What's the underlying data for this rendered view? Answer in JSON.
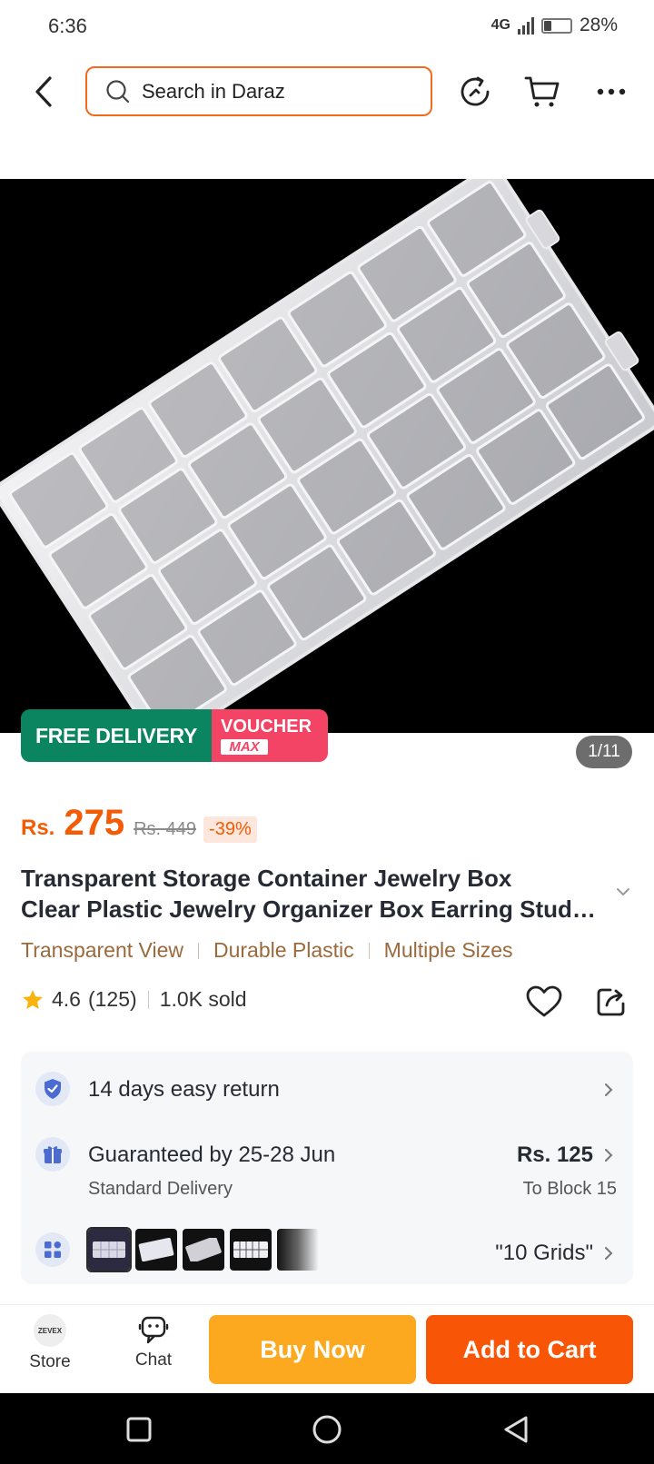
{
  "status_bar": {
    "time": "6:36",
    "network": "4G",
    "battery": "28%",
    "battery_level": 0.28
  },
  "header": {
    "search_placeholder": "Search in Daraz"
  },
  "product": {
    "badges": {
      "free_delivery": "FREE DELIVERY",
      "voucher": "VOUCHER",
      "voucher_max": "MAX"
    },
    "image_counter": "1/11",
    "price": {
      "currency": "Rs.",
      "current": "275",
      "original": "Rs. 449",
      "discount": "-39%"
    },
    "title_line1": "Transparent Storage Container Jewelry Box",
    "title_line2": "Clear Plastic Jewelry Organizer Box Earring Stud Holder",
    "tags": [
      "Transparent View",
      "Durable Plastic",
      "Multiple Sizes"
    ],
    "rating": {
      "score": "4.6",
      "count": "(125)",
      "sold": "1.0K sold"
    }
  },
  "info": {
    "returns": "14 days easy return",
    "delivery": {
      "title": "Guaranteed by 25-28 Jun",
      "subtitle": "Standard Delivery",
      "price": "Rs. 125",
      "location": "To Block 15"
    },
    "variant": {
      "selected": "\"10 Grids\""
    }
  },
  "bottom_bar": {
    "store_label": "Store",
    "store_logo": "ZEVEX",
    "chat_label": "Chat",
    "buy_now": "Buy Now",
    "add_to_cart": "Add to Cart"
  },
  "colors": {
    "brand": "#f85606",
    "buy_now": "#fca91f",
    "free_delivery": "#0a8560",
    "voucher": "#f44466"
  },
  "icons": [
    "back-icon",
    "search-icon",
    "history-icon",
    "cart-icon",
    "more-icon",
    "star-icon",
    "heart-icon",
    "share-icon",
    "shield-check-icon",
    "gift-icon",
    "variants-icon",
    "chevron-right-icon",
    "chat-icon"
  ]
}
